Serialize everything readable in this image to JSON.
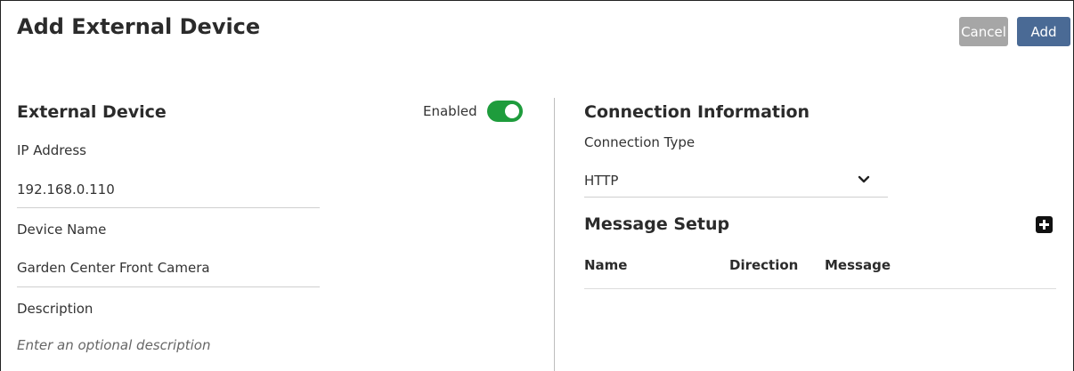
{
  "header": {
    "title": "Add External Device",
    "cancel_label": "Cancel",
    "add_label": "Add"
  },
  "external_device": {
    "section_title": "External Device",
    "enabled_label": "Enabled",
    "enabled": true,
    "ip_label": "IP Address",
    "ip_value": "192.168.0.110",
    "name_label": "Device Name",
    "name_value": "Garden Center Front Camera",
    "description_label": "Description",
    "description_placeholder": "Enter an optional description"
  },
  "connection": {
    "section_title": "Connection Information",
    "type_label": "Connection Type",
    "type_value": "HTTP"
  },
  "message_setup": {
    "section_title": "Message Setup",
    "columns": [
      "Name",
      "Direction",
      "Message"
    ]
  },
  "icons": {
    "add_message": "plus-square-icon",
    "select_chevron": "chevron-down-icon"
  },
  "colors": {
    "accent": "#4a6a95",
    "toggle_on": "#1e9c3c",
    "cancel": "#a6a6a6"
  }
}
